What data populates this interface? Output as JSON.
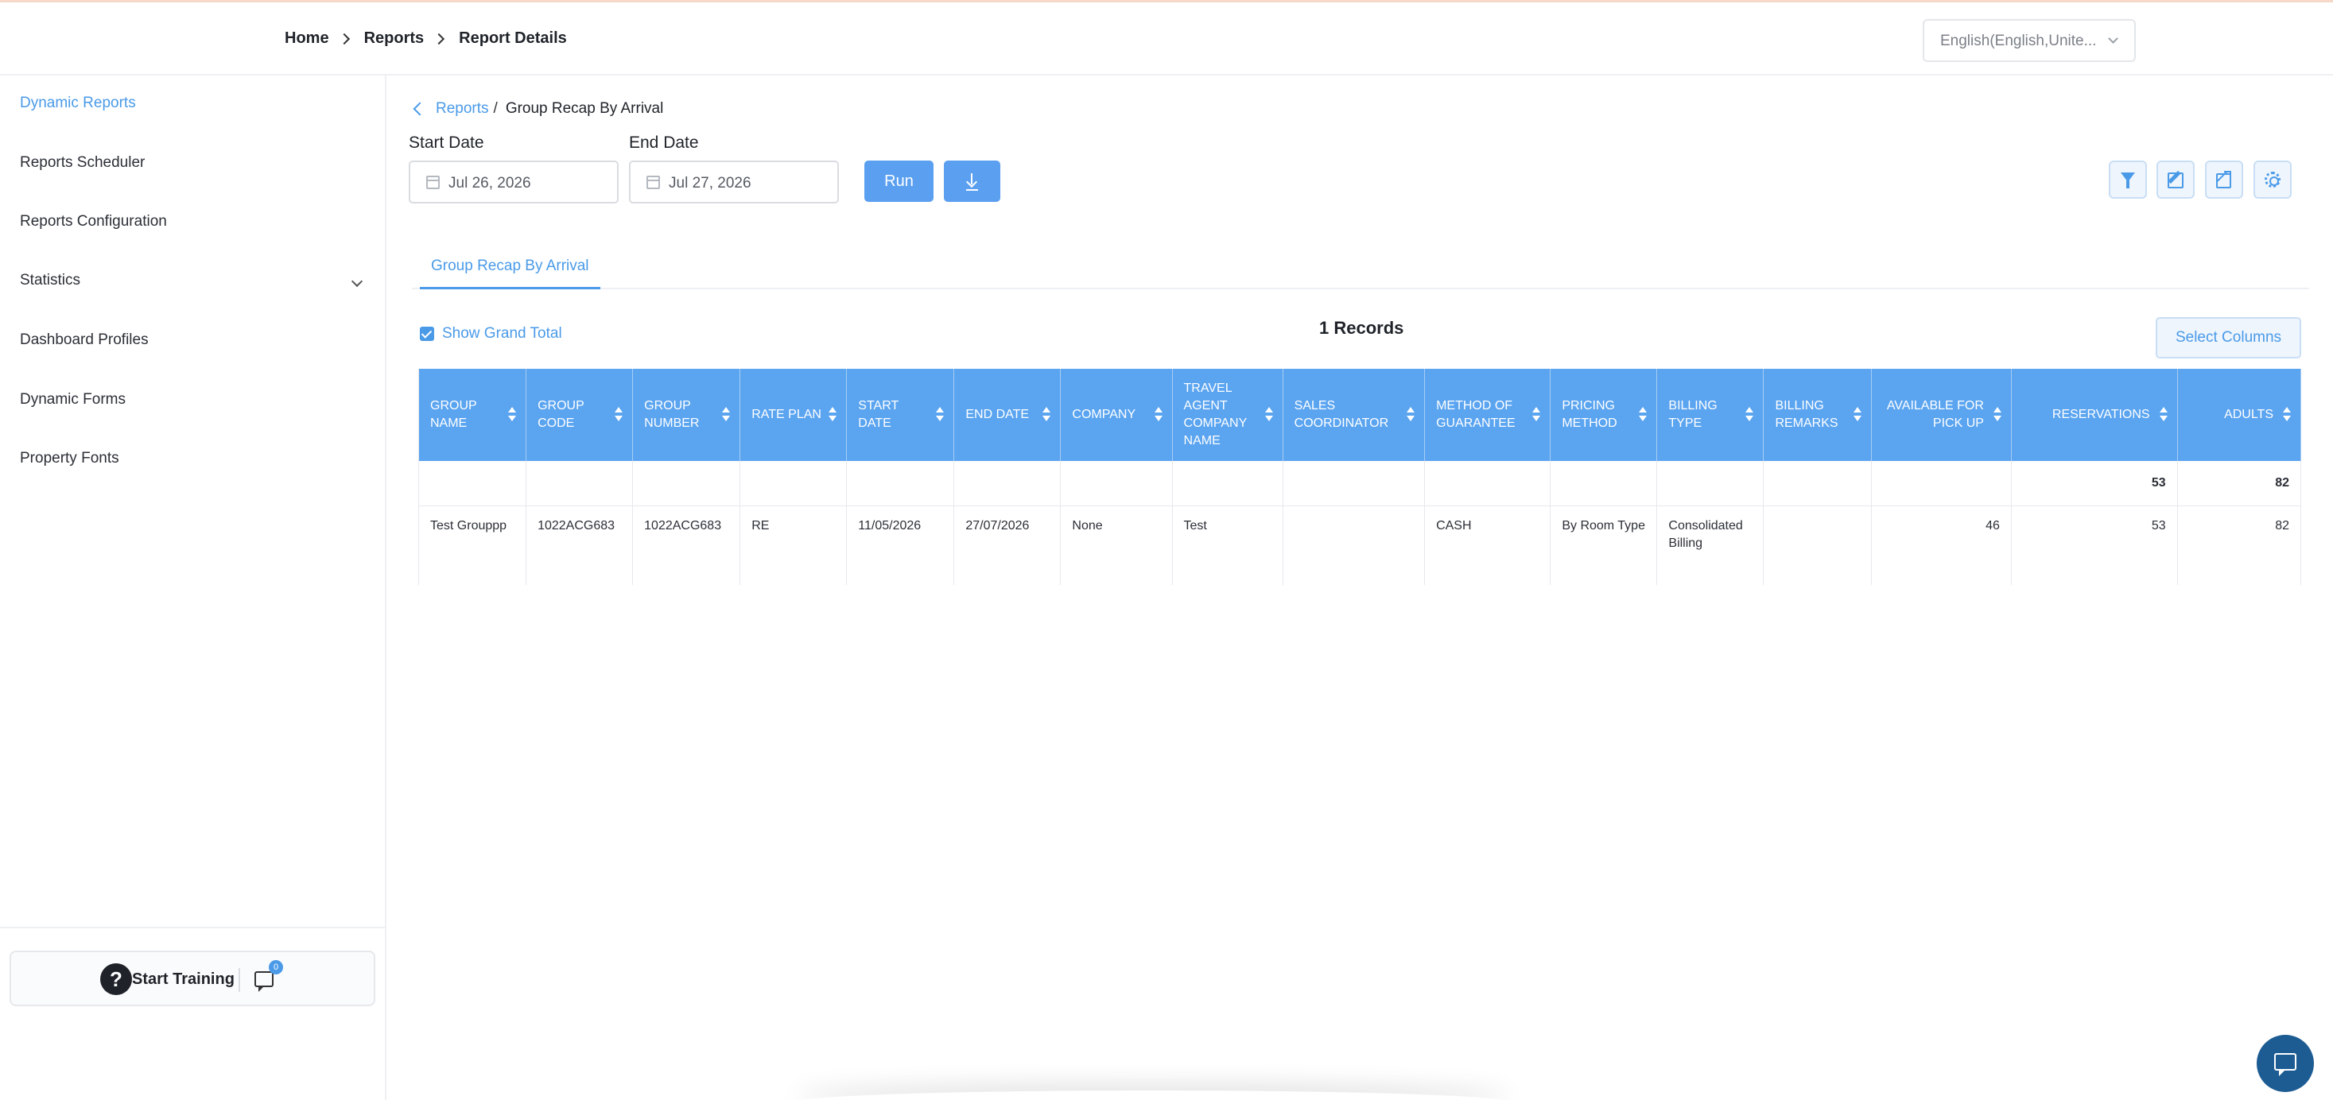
{
  "header": {
    "breadcrumb": [
      "Home",
      "Reports",
      "Report Details"
    ],
    "language": "English(English,Unite..."
  },
  "sidebar": {
    "items": [
      {
        "label": "Dynamic Reports",
        "active": true
      },
      {
        "label": "Reports Scheduler"
      },
      {
        "label": "Reports Configuration"
      },
      {
        "label": "Statistics",
        "expandable": true
      },
      {
        "label": "Dashboard Profiles"
      },
      {
        "label": "Dynamic Forms"
      },
      {
        "label": "Property Fonts"
      }
    ],
    "training_label": "Start Training",
    "chat_badge": "0"
  },
  "main": {
    "back_link": "Reports",
    "back_separator": "/",
    "report_title": "Group Recap By Arrival",
    "start_date_label": "Start Date",
    "start_date_value": "Jul 26, 2026",
    "end_date_label": "End Date",
    "end_date_value": "Jul 27, 2026",
    "run_label": "Run",
    "tab_label": "Group Recap By Arrival",
    "show_grand_total_label": "Show Grand Total",
    "records_label": "1 Records",
    "select_columns_label": "Select Columns",
    "accent_color": "#4a9ae8",
    "header_color": "#5aa4f0"
  },
  "table": {
    "columns": [
      {
        "label": "GROUP NAME"
      },
      {
        "label": "GROUP CODE"
      },
      {
        "label": "GROUP NUMBER"
      },
      {
        "label": "RATE PLAN"
      },
      {
        "label": "START DATE"
      },
      {
        "label": "END DATE"
      },
      {
        "label": "COMPANY"
      },
      {
        "label": "TRAVEL AGENT COMPANY NAME"
      },
      {
        "label": "SALES COORDINATOR"
      },
      {
        "label": "METHOD OF GUARANTEE"
      },
      {
        "label": "PRICING METHOD"
      },
      {
        "label": "BILLING TYPE"
      },
      {
        "label": "BILLING REMARKS"
      },
      {
        "label": "AVAILABLE FOR PICK UP"
      },
      {
        "label": "RESERVATIONS"
      },
      {
        "label": "ADULTS"
      }
    ],
    "total_row": [
      "",
      "",
      "",
      "",
      "",
      "",
      "",
      "",
      "",
      "",
      "",
      "",
      "",
      "",
      "53",
      "82"
    ],
    "rows": [
      [
        "Test Grouppp",
        "1022ACG683",
        "1022ACG683",
        "RE",
        "11/05/2026",
        "27/07/2026",
        "None",
        "Test",
        "",
        "CASH",
        "By Room Type",
        "Consolidated Billing",
        "",
        "46",
        "53",
        "82"
      ]
    ]
  }
}
